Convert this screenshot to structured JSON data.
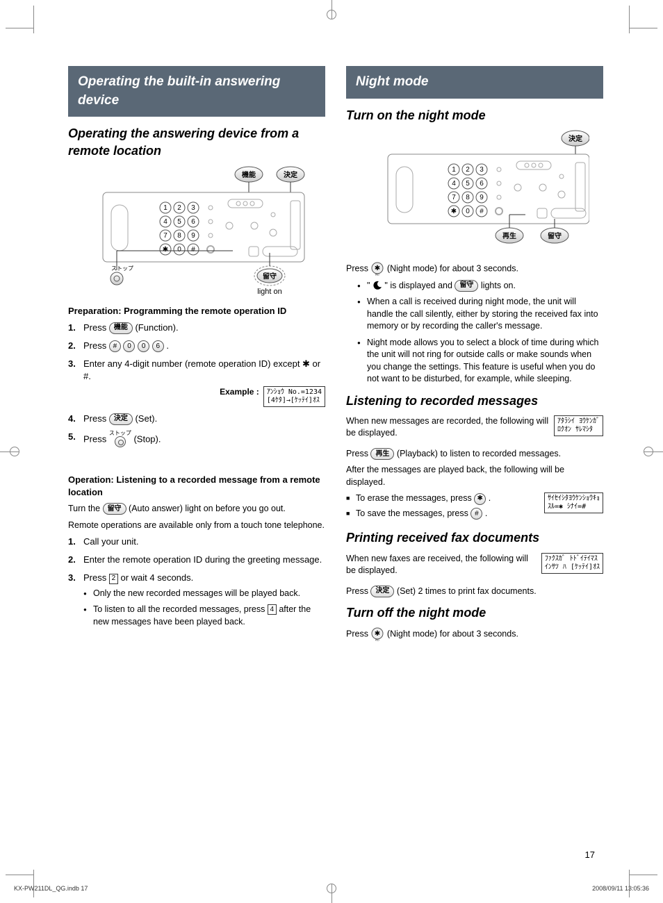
{
  "left": {
    "band": "Operating the built-in answering device",
    "h2": "Operating the answering device from a remote location",
    "diagram": {
      "kinou": "機能",
      "kettei": "決定",
      "rusu": "留守",
      "stop_label": "ストップ",
      "light_on": "light on"
    },
    "prep_heading": "Preparation: Programming the remote operation ID",
    "prep_steps": {
      "s1_a": "Press ",
      "s1_btn": "機能",
      "s1_b": " (Function).",
      "s2_a": "Press ",
      "s2_k1": "#",
      "s2_k2": "0",
      "s2_k3": "0",
      "s2_k4": "6",
      "s2_b": ".",
      "s3": "Enter any 4-digit number (remote operation ID) except ✱ or #.",
      "example_label": "Example :",
      "example_lcd": "ｱﾝｼｮｳ No.=1234\n[4ｹﾀ]→[ｹｯﾃｲ]ｵｽ",
      "s4_a": "Press ",
      "s4_btn": "決定",
      "s4_b": " (Set).",
      "s5_a": "Press ",
      "s5_label": "ストップ",
      "s5_b": " (Stop)."
    },
    "op_heading": "Operation: Listening to a recorded message from a remote location",
    "op_line1_a": "Turn the ",
    "op_line1_btn": "留守",
    "op_line1_b": " (Auto answer) light on before you go out.",
    "op_line2": "Remote operations are available only from a touch tone telephone.",
    "op_steps": {
      "s1": "Call your unit.",
      "s2": "Enter the remote operation ID during the greeting message.",
      "s3_a": "Press ",
      "s3_key": "2",
      "s3_b": " or wait 4 seconds.",
      "s3_bul1": "Only the new recorded messages will be played back.",
      "s3_bul2_a": "To listen to all the recorded messages, press ",
      "s3_bul2_key": "4",
      "s3_bul2_b": " after the new messages have been played back."
    }
  },
  "right": {
    "band": "Night mode",
    "h2_on": "Turn on the night mode",
    "diagram": {
      "kettei": "決定",
      "saisei": "再生",
      "rusu": "留守"
    },
    "on_line_a": "Press ",
    "on_line_b": " (Night mode) for about 3 seconds.",
    "on_bullets": {
      "b1_a": "\" ",
      "b1_b": " \" is displayed and ",
      "b1_btn": "留守",
      "b1_c": " lights on.",
      "b2": "When a call is received during night mode, the unit will handle the call silently, either by storing the received fax into memory or by recording the caller's message.",
      "b3": "Night mode allows you to select a block of time during which the unit will not ring for outside calls or make sounds when you change the settings. This feature is useful when you do not want to be disturbed, for example, while sleeping."
    },
    "h2_listen": "Listening to recorded messages",
    "listen_p1": "When new messages are recorded, the following will be displayed.",
    "listen_lcd1": "ｱﾀﾗｼｲ ﾖｳｹﾝｶﾞ\nﾛｸｵﾝ ｻﾚﾏｼﾀ",
    "listen_p2_a": "Press ",
    "listen_p2_btn": "再生",
    "listen_p2_b": " (Playback) to listen to recorded messages.",
    "listen_p3": "After the messages are played back, the following will be displayed.",
    "listen_erase_a": "To erase the messages, press ",
    "listen_erase_key": "✱",
    "listen_erase_b": ".",
    "listen_save_a": "To save the messages, press ",
    "listen_save_key": "#",
    "listen_save_b": ".",
    "listen_lcd2": "ｻｲｾｲｼﾀﾖｳｹﾝｼｮｳｷｮ\nｽﾙ=✱ ｼﾅｲ=#",
    "h2_print": "Printing received fax documents",
    "print_p1": "When new faxes are received, the following will be displayed.",
    "print_lcd": "ﾌｧｸｽｶﾞ ﾄﾄﾞｲﾃｲﾏｽ\nｲﾝｻﾂ ﾊ [ｹｯﾃｲ]ｵｽ",
    "print_p2_a": "Press ",
    "print_p2_btn": "決定",
    "print_p2_b": " (Set) 2 times to print fax documents.",
    "h2_off": "Turn off the night mode",
    "off_line_a": "Press ",
    "off_line_b": " (Night mode) for about 3 seconds."
  },
  "page_number": "17",
  "footer_left": "KX-PW211DL_QG.indb   17",
  "footer_right": "2008/09/11   13:05:36"
}
